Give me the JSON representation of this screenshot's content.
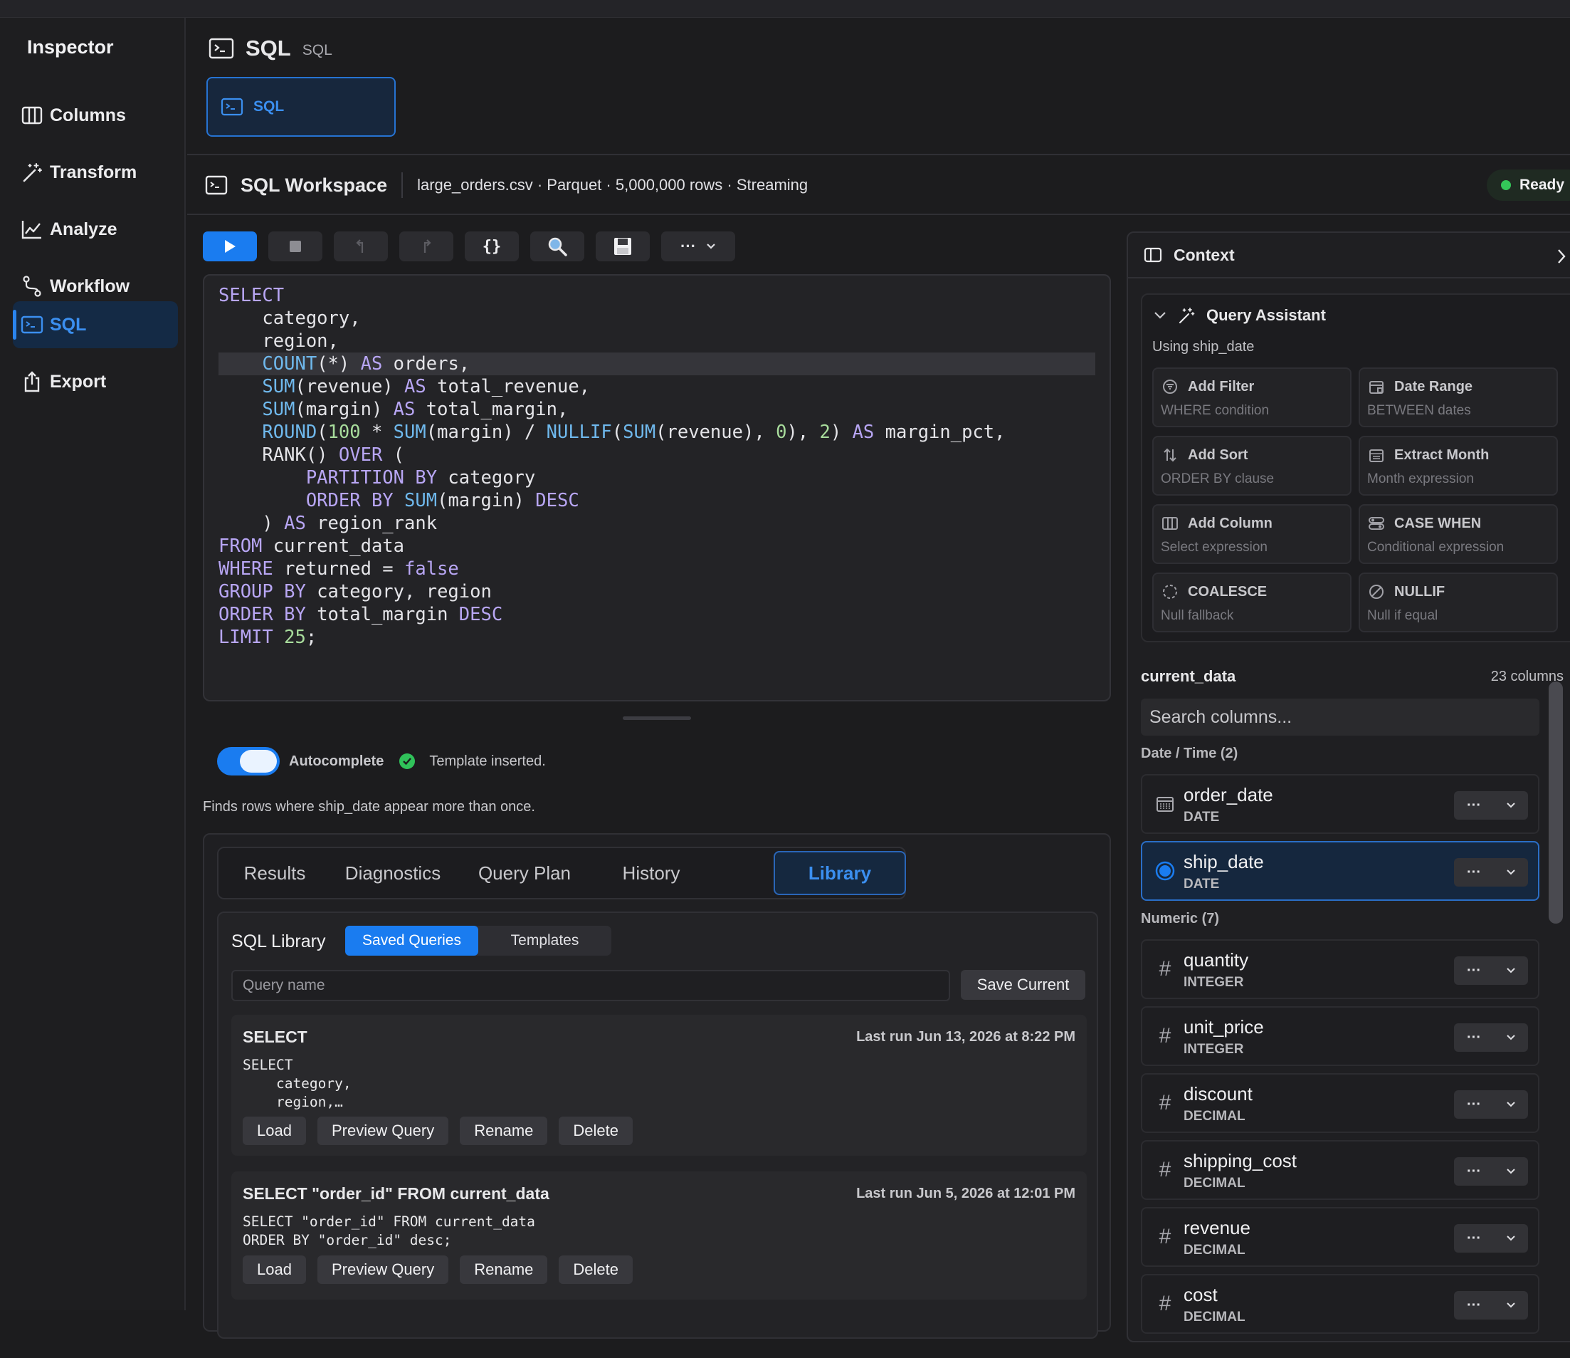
{
  "sidebar": {
    "title": "Inspector",
    "items": [
      {
        "label": "Columns",
        "icon": "columns-icon"
      },
      {
        "label": "Transform",
        "icon": "magic-wand-icon"
      },
      {
        "label": "Analyze",
        "icon": "line-chart-icon"
      },
      {
        "label": "Workflow",
        "icon": "workflow-icon"
      },
      {
        "label": "SQL",
        "icon": "terminal-icon",
        "active": true
      },
      {
        "label": "Export",
        "icon": "share-icon"
      }
    ]
  },
  "header": {
    "title": "SQL",
    "subtitle": "SQL",
    "tab_label": "SQL"
  },
  "workspace": {
    "title": "SQL Workspace",
    "meta": "large_orders.csv · Parquet · 5,000,000 rows · Streaming",
    "status": "Ready",
    "status_color": "#34c759"
  },
  "toolbar": {
    "buttons": [
      "run-icon",
      "stop-icon",
      "undo-icon",
      "redo-icon",
      "format-braces-icon",
      "search-icon",
      "save-icon",
      "more-icon"
    ]
  },
  "editor": {
    "highlighted_line": 4,
    "lines": [
      "SELECT",
      "    category,",
      "    region,",
      "    COUNT(*) AS orders,",
      "    SUM(revenue) AS total_revenue,",
      "    SUM(margin) AS total_margin,",
      "    ROUND(100 * SUM(margin) / NULLIF(SUM(revenue), 0), 2) AS margin_pct,",
      "    RANK() OVER (",
      "        PARTITION BY category",
      "        ORDER BY SUM(margin) DESC",
      "    ) AS region_rank",
      "FROM current_data",
      "WHERE returned = false",
      "GROUP BY category, region",
      "ORDER BY total_margin DESC",
      "LIMIT 25;"
    ]
  },
  "autocomplete": {
    "label": "Autocomplete",
    "enabled": true,
    "message": "Template inserted."
  },
  "hint": "Finds rows where ship_date appear more than once.",
  "results": {
    "tabs": [
      "Results",
      "Diagnostics",
      "Query Plan",
      "History",
      "Library"
    ],
    "active_tab": "Library",
    "library": {
      "title": "SQL Library",
      "segments": [
        "Saved Queries",
        "Templates"
      ],
      "active_segment": "Saved Queries",
      "name_placeholder": "Query name",
      "save_label": "Save Current",
      "queries": [
        {
          "title": "SELECT",
          "last_run": "Last run Jun 13, 2026 at 8:22 PM",
          "preview": "SELECT\n    category,\n    region,…",
          "actions": [
            "Load",
            "Preview Query",
            "Rename",
            "Delete"
          ]
        },
        {
          "title": "SELECT \"order_id\" FROM current_data",
          "last_run": "Last run Jun 5, 2026 at 12:01 PM",
          "preview": "SELECT \"order_id\" FROM current_data\nORDER BY \"order_id\" desc;",
          "actions": [
            "Load",
            "Preview Query",
            "Rename",
            "Delete"
          ]
        }
      ]
    }
  },
  "context": {
    "title": "Context",
    "assistant": {
      "title": "Query Assistant",
      "subtitle": "Using ship_date",
      "actions": [
        {
          "name": "Add Filter",
          "desc": "WHERE condition",
          "icon": "filter-icon"
        },
        {
          "name": "Date Range",
          "desc": "BETWEEN dates",
          "icon": "calendar-range-icon"
        },
        {
          "name": "Add Sort",
          "desc": "ORDER BY clause",
          "icon": "sort-icon"
        },
        {
          "name": "Extract Month",
          "desc": "Month expression",
          "icon": "calendar-icon"
        },
        {
          "name": "Add Column",
          "desc": "Select expression",
          "icon": "columns-icon"
        },
        {
          "name": "CASE WHEN",
          "desc": "Conditional expression",
          "icon": "toggle-icon"
        },
        {
          "name": "COALESCE",
          "desc": "Null fallback",
          "icon": "dashed-circle-icon"
        },
        {
          "name": "NULLIF",
          "desc": "Null if equal",
          "icon": "no-entry-icon"
        }
      ]
    },
    "table": {
      "name": "current_data",
      "count": "23 columns",
      "search_placeholder": "Search columns...",
      "groups": [
        {
          "label": "Date / Time (2)",
          "columns": [
            {
              "name": "order_date",
              "type": "DATE",
              "icon": "calendar-icon"
            },
            {
              "name": "ship_date",
              "type": "DATE",
              "icon": "radio-selected-icon",
              "selected": true
            }
          ]
        },
        {
          "label": "Numeric (7)",
          "columns": [
            {
              "name": "quantity",
              "type": "INTEGER",
              "icon": "hash-icon"
            },
            {
              "name": "unit_price",
              "type": "INTEGER",
              "icon": "hash-icon"
            },
            {
              "name": "discount",
              "type": "DECIMAL",
              "icon": "hash-icon"
            },
            {
              "name": "shipping_cost",
              "type": "DECIMAL",
              "icon": "hash-icon"
            },
            {
              "name": "revenue",
              "type": "DECIMAL",
              "icon": "hash-icon"
            },
            {
              "name": "cost",
              "type": "DECIMAL",
              "icon": "hash-icon"
            }
          ]
        }
      ]
    }
  },
  "colors": {
    "accent": "#1a7cf0",
    "keyword": "#b8a6f4",
    "function": "#6fb8ec",
    "number": "#a8dc9c"
  }
}
